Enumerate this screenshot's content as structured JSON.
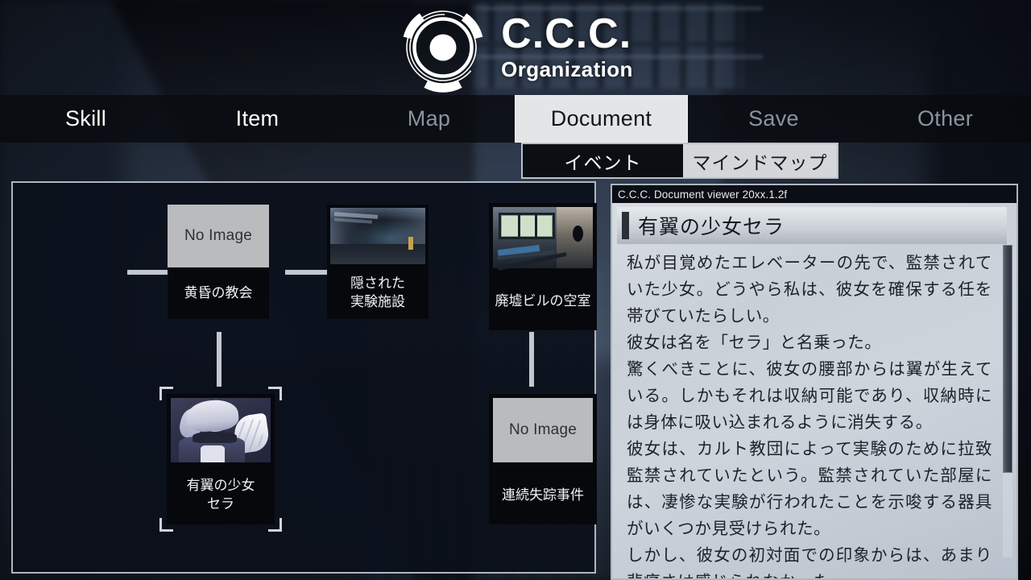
{
  "logo": {
    "title": "C.C.C.",
    "subtitle": "Organization",
    "mark_icon": "ccc-ring-logo-icon"
  },
  "tabs": [
    {
      "label": "Skill",
      "state": "normal"
    },
    {
      "label": "Item",
      "state": "normal"
    },
    {
      "label": "Map",
      "state": "dim"
    },
    {
      "label": "Document",
      "state": "active"
    },
    {
      "label": "Save",
      "state": "dim"
    },
    {
      "label": "Other",
      "state": "dim"
    }
  ],
  "subtabs": [
    {
      "label": "イベント",
      "state": "active"
    },
    {
      "label": "マインドマップ",
      "state": "inactive"
    }
  ],
  "mindmap": {
    "no_image_label": "No Image",
    "nodes": [
      {
        "id": "church",
        "label_lines": [
          "黄昏の教会"
        ],
        "thumb": "no-image",
        "selected": false
      },
      {
        "id": "facility",
        "label_lines": [
          "隠された",
          "実験施設"
        ],
        "thumb": "corridor",
        "selected": false
      },
      {
        "id": "ruin",
        "label_lines": [
          "廃墟ビルの空室"
        ],
        "thumb": "ruin",
        "selected": false
      },
      {
        "id": "sera",
        "label_lines": [
          "有翼の少女",
          "セラ"
        ],
        "thumb": "girl",
        "selected": true
      },
      {
        "id": "missing",
        "label_lines": [
          "連続失踪事件"
        ],
        "thumb": "no-image",
        "selected": false
      }
    ]
  },
  "document": {
    "viewer_title": "C.C.C. Document viewer 20xx.1.2f",
    "heading": "有翼の少女セラ",
    "body": "私が目覚めたエレベーターの先で、監禁されていた少女。どうやら私は、彼女を確保する任を帯びていたらしい。\n彼女は名を「セラ」と名乗った。\n驚くべきことに、彼女の腰部からは翼が生えている。しかもそれは収納可能であり、収納時には身体に吸い込まれるように消失する。\n彼女は、カルト教団によって実験のために拉致監禁されていたという。監禁されていた部屋には、凄惨な実験が行われたことを示唆する器具がいくつか見受けられた。\nしかし、彼女の初対面での印象からは、あまり悲痛さは感じられなかった。\n私の来訪に対して、多少の動揺が見られた気はした"
  },
  "colors": {
    "background": "#141a24",
    "panel_border": "#aeb6c0",
    "tab_active_bg": "#e3e5e6",
    "node_bg": "#06080c",
    "connector": "#c2c8cf",
    "doc_paper": "#cdd4dc"
  }
}
